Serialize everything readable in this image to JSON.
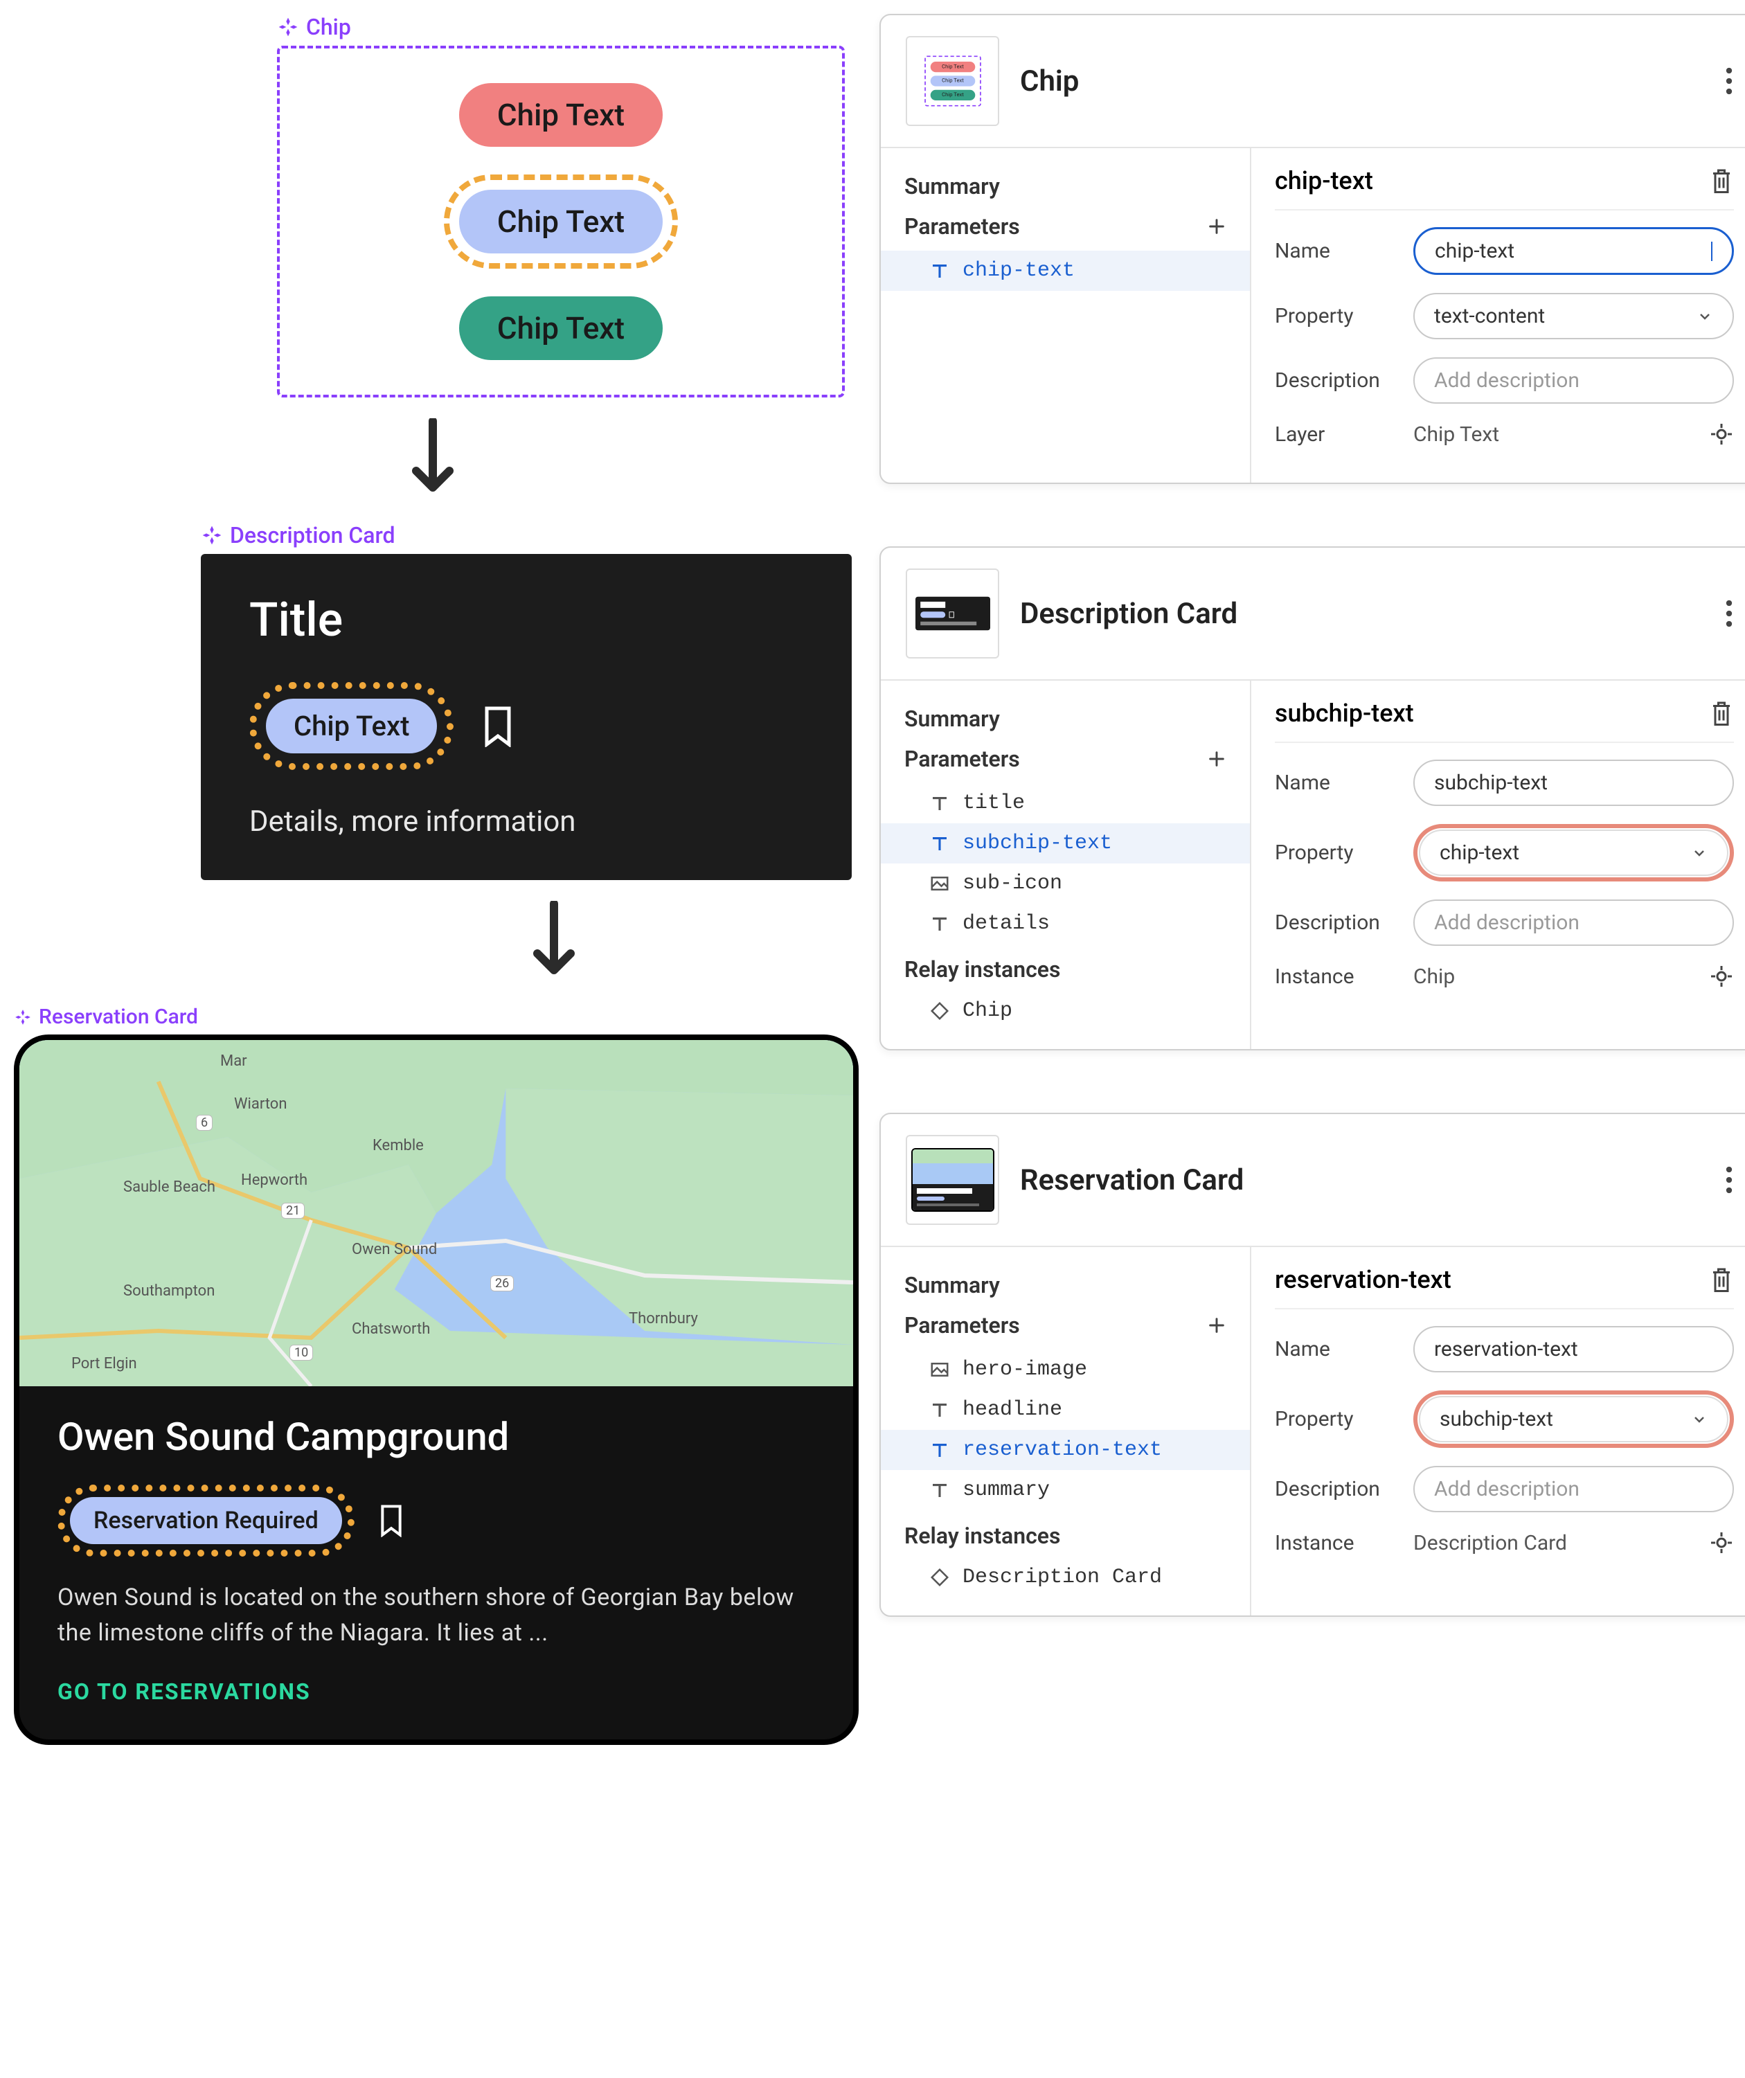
{
  "chipCanvas": {
    "label": "Chip",
    "chips": {
      "red": "Chip Text",
      "blue": "Chip Text",
      "green": "Chip Text"
    }
  },
  "descCanvas": {
    "label": "Description Card",
    "title": "Title",
    "chip": "Chip Text",
    "details": "Details, more information"
  },
  "resCanvas": {
    "label": "Reservation Card",
    "mapLabels": {
      "mar": "Mar",
      "wiarton": "Wiarton",
      "saubleBeach": "Sauble Beach",
      "hepworth": "Hepworth",
      "kemble": "Kemble",
      "owenSound": "Owen Sound",
      "southampton": "Southampton",
      "chatsworth": "Chatsworth",
      "portElgin": "Port Elgin",
      "thornbury": "Thornbury",
      "r6": "6",
      "r21": "21",
      "r26": "26",
      "r10": "10"
    },
    "headline": "Owen Sound Campground",
    "chip": "Reservation Required",
    "summary": "Owen Sound is located on the southern shore of Georgian Bay below the limestone cliffs of the Niagara. It lies at ...",
    "cta": "GO TO RESERVATIONS"
  },
  "panels": {
    "chip": {
      "title": "Chip",
      "left": {
        "summary": "Summary",
        "parameters": "Parameters",
        "items": {
          "chipText": "chip-text"
        }
      },
      "right": {
        "heading": "chip-text",
        "nameLabel": "Name",
        "nameValue": "chip-text",
        "propLabel": "Property",
        "propValue": "text-content",
        "descLabel": "Description",
        "descPlaceholder": "Add description",
        "layerLabel": "Layer",
        "layerValue": "Chip Text"
      }
    },
    "desc": {
      "title": "Description Card",
      "left": {
        "summary": "Summary",
        "parameters": "Parameters",
        "relay": "Relay instances",
        "items": {
          "title": "title",
          "subchip": "subchip-text",
          "subicon": "sub-icon",
          "details": "details",
          "relayChip": "Chip"
        }
      },
      "right": {
        "heading": "subchip-text",
        "nameLabel": "Name",
        "nameValue": "subchip-text",
        "propLabel": "Property",
        "propValue": "chip-text",
        "descLabel": "Description",
        "descPlaceholder": "Add description",
        "instanceLabel": "Instance",
        "instanceValue": "Chip"
      }
    },
    "res": {
      "title": "Reservation Card",
      "left": {
        "summary": "Summary",
        "parameters": "Parameters",
        "relay": "Relay instances",
        "items": {
          "hero": "hero-image",
          "headline": "headline",
          "restext": "reservation-text",
          "summary": "summary",
          "relayDesc": "Description Card"
        }
      },
      "right": {
        "heading": "reservation-text",
        "nameLabel": "Name",
        "nameValue": "reservation-text",
        "propLabel": "Property",
        "propValue": "subchip-text",
        "descLabel": "Description",
        "descPlaceholder": "Add description",
        "instanceLabel": "Instance",
        "instanceValue": "Description Card"
      }
    }
  }
}
